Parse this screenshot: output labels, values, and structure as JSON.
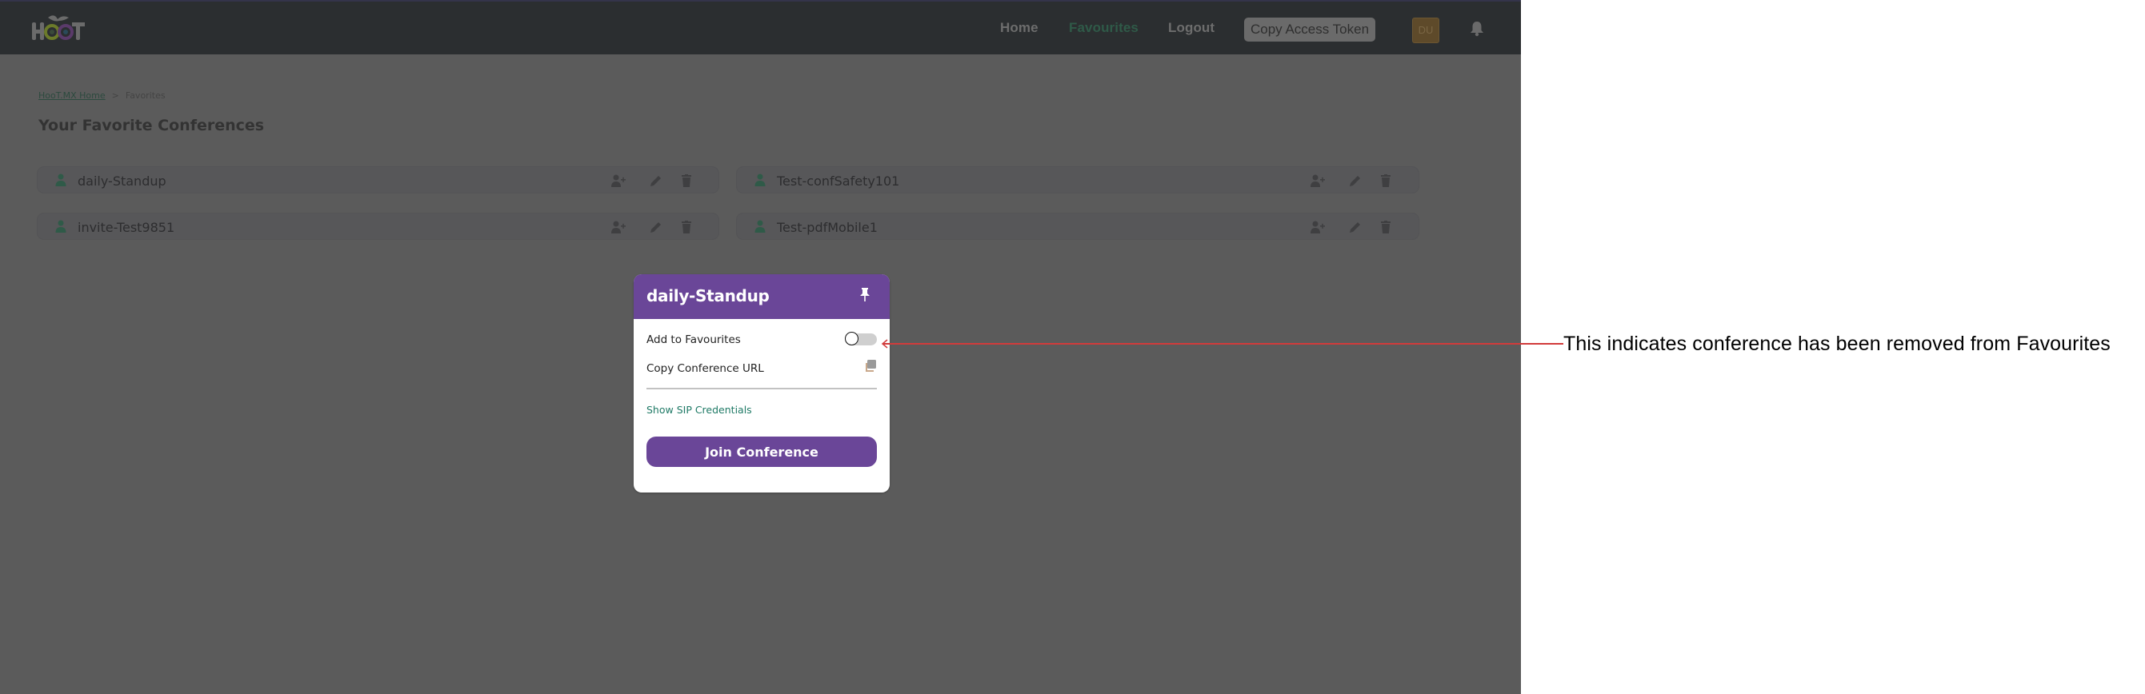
{
  "header": {
    "logo_text": "HooT",
    "nav": [
      {
        "label": "Home",
        "active": false
      },
      {
        "label": "Favourites",
        "active": true
      },
      {
        "label": "Logout",
        "active": false
      }
    ],
    "copy_token_label": "Copy Access Token",
    "avatar_initials": "DU",
    "bell_icon": "bell-icon"
  },
  "breadcrumb": {
    "home_label": "HooT.MX Home",
    "separator": ">",
    "current": "Favorites"
  },
  "page_title": "Your Favorite Conferences",
  "conferences": [
    {
      "name": "daily-Standup",
      "icons": [
        "person-icon",
        "add-user-icon",
        "edit-icon",
        "trash-icon"
      ]
    },
    {
      "name": "Test-confSafety101",
      "icons": [
        "person-icon",
        "add-user-icon",
        "edit-icon",
        "trash-icon"
      ]
    },
    {
      "name": "invite-Test9851",
      "icons": [
        "person-icon",
        "add-user-icon",
        "edit-icon",
        "trash-icon"
      ]
    },
    {
      "name": "Test-pdfMobile1",
      "icons": [
        "person-icon",
        "add-user-icon",
        "edit-icon",
        "trash-icon"
      ]
    }
  ],
  "modal": {
    "title": "daily-Standup",
    "pin_icon": "pin-icon",
    "favourites_label": "Add to Favourites",
    "favourites_on": false,
    "copy_url_label": "Copy Conference URL",
    "copy_icon": "copy-icon",
    "sip_link": "Show SIP Credentials",
    "join_label": "Join Conference"
  },
  "annotation": {
    "text": "This indicates conference has been removed from Favourites"
  },
  "colors": {
    "brand_purple": "#6a4698",
    "link_green": "#1f7a66",
    "annotation_red": "#d13b3b",
    "overlay_gray": "#5b5b5b"
  }
}
